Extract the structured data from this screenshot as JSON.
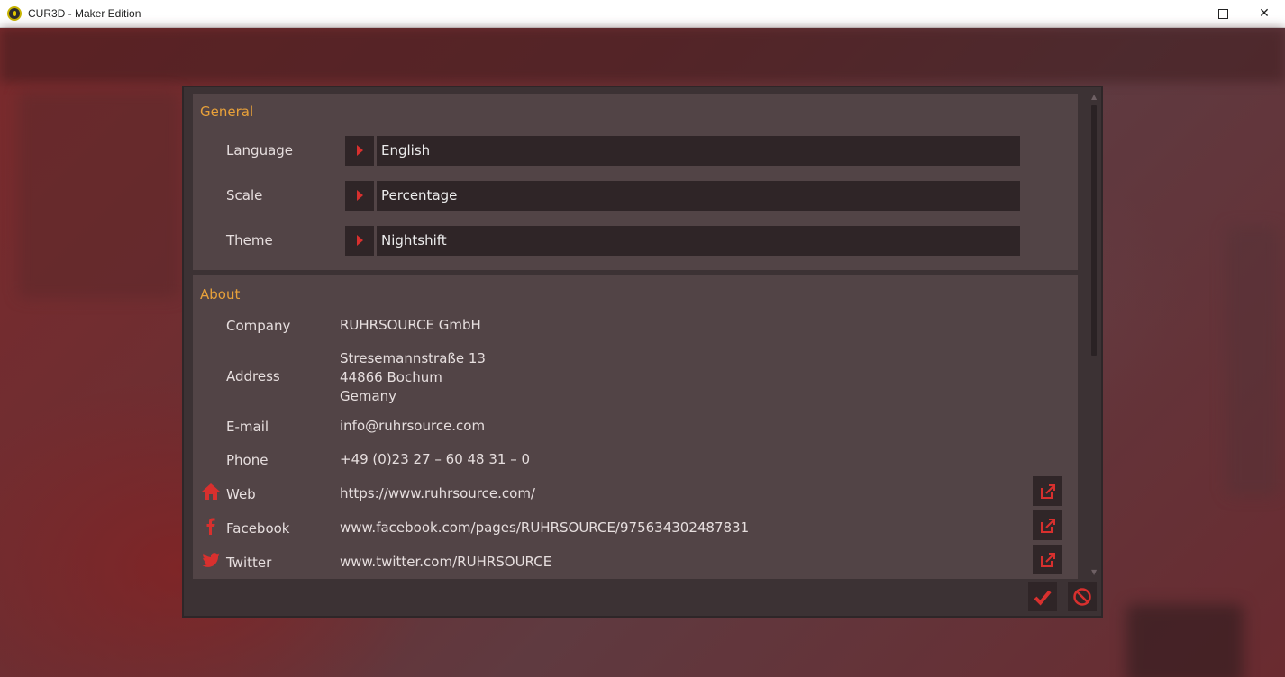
{
  "window": {
    "title": "CUR3D - Maker Edition",
    "minimize_icon": "minimize-icon",
    "maximize_icon": "maximize-icon",
    "close_label": "✕"
  },
  "colors": {
    "accent": "#e8a13a",
    "icon_red": "#d8302e",
    "panel": "#524446",
    "field": "#2f2527"
  },
  "general": {
    "title": "General",
    "rows": [
      {
        "label": "Language",
        "value": "English"
      },
      {
        "label": "Scale",
        "value": "Percentage"
      },
      {
        "label": "Theme",
        "value": "Nightshift"
      }
    ]
  },
  "about": {
    "title": "About",
    "company": {
      "label": "Company",
      "value": "RUHRSOURCE GmbH"
    },
    "address": {
      "label": "Address",
      "line1": "Stresemannstraße 13",
      "line2": "44866 Bochum",
      "line3": "Gemany"
    },
    "email": {
      "label": "E-mail",
      "value": "info@ruhrsource.com"
    },
    "phone": {
      "label": "Phone",
      "value": "+49 (0)23 27 – 60 48 31 – 0"
    },
    "links": [
      {
        "label": "Web",
        "value": "https://www.ruhrsource.com/",
        "icon": "home-icon"
      },
      {
        "label": "Facebook",
        "value": "www.facebook.com/pages/RUHRSOURCE/975634302487831",
        "icon": "facebook-icon"
      },
      {
        "label": "Twitter",
        "value": "www.twitter.com/RUHRSOURCE",
        "icon": "twitter-icon"
      }
    ]
  },
  "footer": {
    "ok_icon": "checkmark-icon",
    "cancel_icon": "prohibited-icon"
  }
}
